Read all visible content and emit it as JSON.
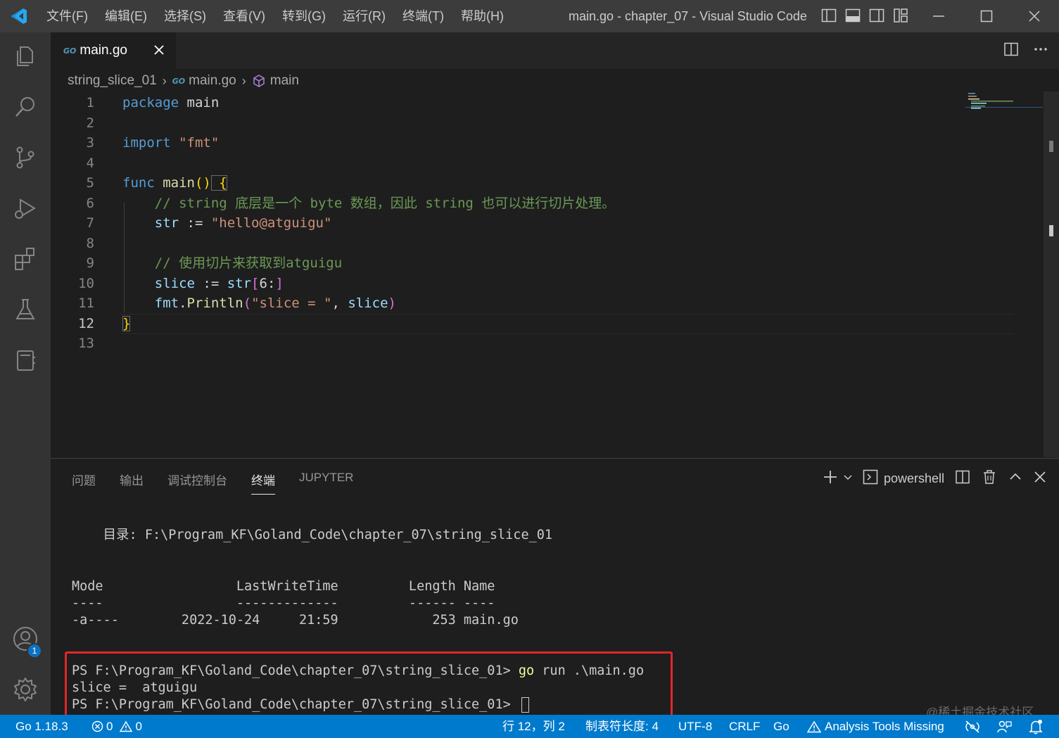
{
  "window": {
    "title": "main.go - chapter_07 - Visual Studio Code",
    "menu": [
      "文件(F)",
      "编辑(E)",
      "选择(S)",
      "查看(V)",
      "转到(G)",
      "运行(R)",
      "终端(T)",
      "帮助(H)"
    ]
  },
  "activity_bar": {
    "items": [
      "explorer-icon",
      "search-icon",
      "source-control-icon",
      "run-debug-icon",
      "extensions-icon",
      "testing-icon",
      "notebook-icon"
    ],
    "accounts_badge": "1"
  },
  "editor": {
    "tab": {
      "icon_text": "GO",
      "label": "main.go"
    },
    "breadcrumb": {
      "folder": "string_slice_01",
      "file": "main.go",
      "symbol": "main"
    },
    "line_numbers": [
      "1",
      "2",
      "3",
      "4",
      "5",
      "6",
      "7",
      "8",
      "9",
      "10",
      "11",
      "12",
      "13"
    ],
    "active_line": "12",
    "code": {
      "l1_kw": "package",
      "l1_name": " main",
      "l3_kw": "import",
      "l3_str": " \"fmt\"",
      "l5_kw": "func",
      "l5_fn": " main",
      "l5_paren": "()",
      "l5_brace": " {",
      "l6_comment": "    // string 底层是一个 byte 数组，因此 string 也可以进行切片处理。",
      "l7_var": "    str",
      "l7_op": " := ",
      "l7_str": "\"hello@atguigu\"",
      "l9_comment": "    // 使用切片来获取到atguigu",
      "l10_var": "    slice",
      "l10_op": " := ",
      "l10_str_var": "str",
      "l10_br1": "[",
      "l10_idx": "6:",
      "l10_br2": "]",
      "l11_pkg": "    fmt",
      "l11_dot": ".",
      "l11_fn": "Println",
      "l11_p1": "(",
      "l11_str": "\"slice = \"",
      "l11_comma": ", ",
      "l11_arg": "slice",
      "l11_p2": ")",
      "l12_brace": "}"
    }
  },
  "panel": {
    "tabs": [
      "问题",
      "输出",
      "调试控制台",
      "终端",
      "JUPYTER"
    ],
    "active_tab": "终端",
    "shell_label": "powershell",
    "terminal": {
      "directory_line": "    目录: F:\\Program_KF\\Goland_Code\\chapter_07\\string_slice_01",
      "header": "Mode                 LastWriteTime         Length Name",
      "separator": "----                 -------------         ------ ----",
      "row": "-a----        2022-10-24     21:59            253 main.go",
      "prompt1": "PS F:\\Program_KF\\Goland_Code\\chapter_07\\string_slice_01> ",
      "cmd_go": "go",
      "cmd_rest": " run .\\main.go",
      "output": "slice =  atguigu",
      "prompt2": "PS F:\\Program_KF\\Goland_Code\\chapter_07\\string_slice_01> "
    }
  },
  "status_bar": {
    "go_version": "Go 1.18.3",
    "errors": "0",
    "warnings": "0",
    "position": "行 12，列 2",
    "tab_size": "制表符长度: 4",
    "encoding": "UTF-8",
    "eol": "CRLF",
    "language": "Go",
    "analysis": "Analysis Tools Missing"
  },
  "watermark": "@稀土掘金技术社区",
  "colors": {
    "statusbar": "#007acc",
    "highlight_box": "#e0272a",
    "activity_bar": "#333333",
    "editor_bg": "#1e1e1e"
  }
}
